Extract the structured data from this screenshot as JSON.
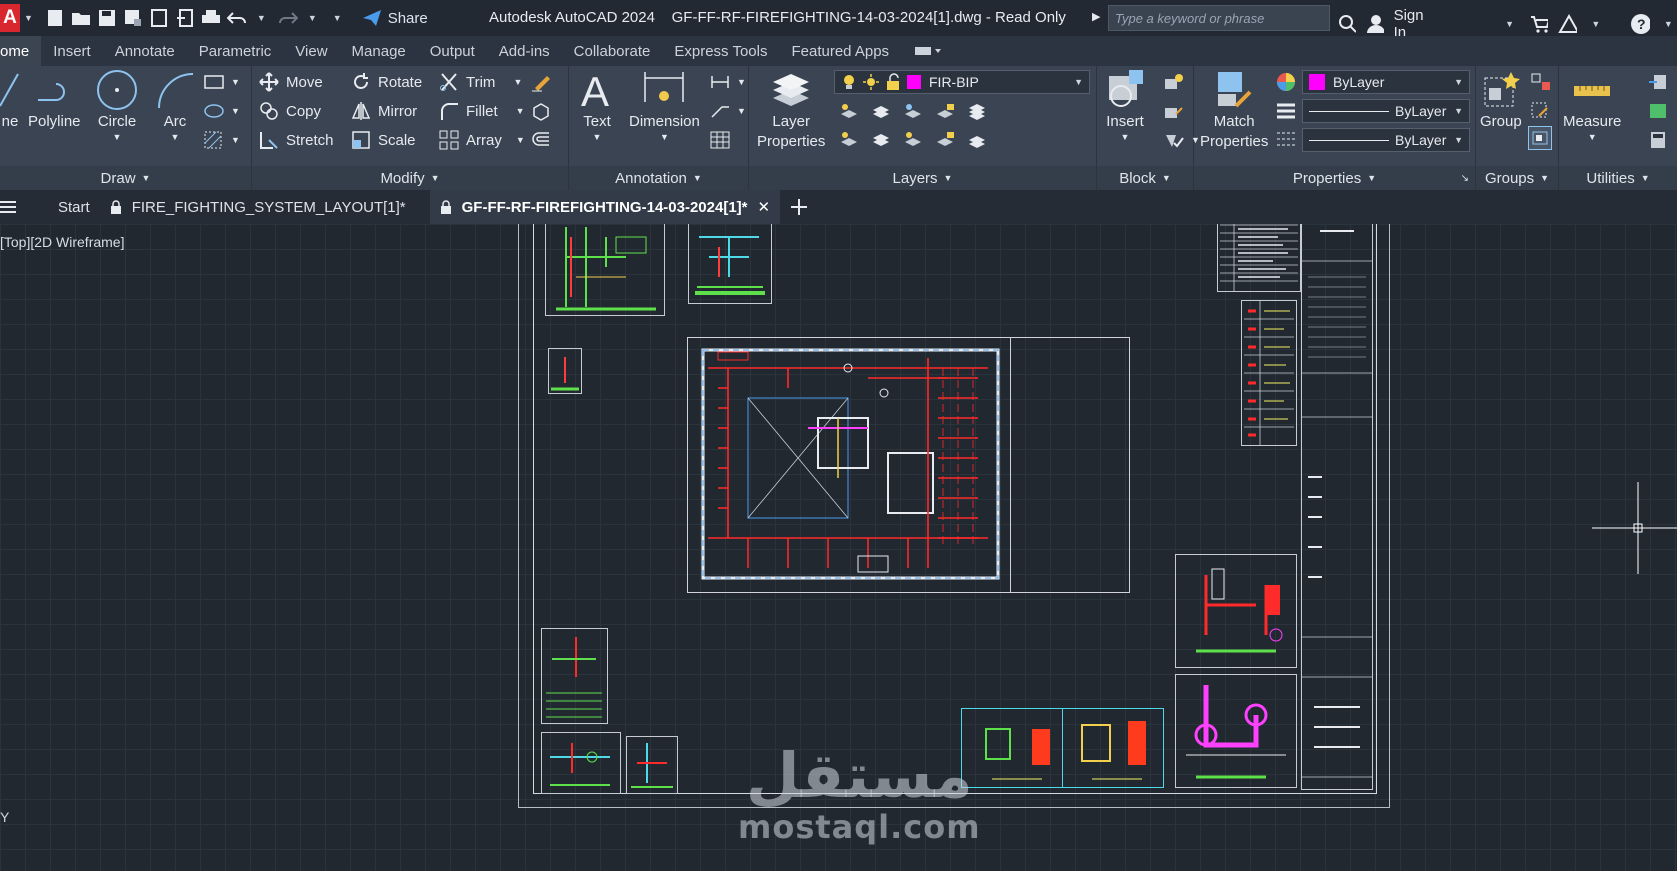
{
  "app": {
    "logo_letter": "A",
    "share_label": "Share",
    "title": "Autodesk AutoCAD 2024    GF-FF-RF-FIREFIGHTING-14-03-2024[1].dwg - Read Only",
    "search_placeholder": "Type a keyword or phrase",
    "sign_in": "Sign In"
  },
  "ribbon_tabs": [
    "ome",
    "Insert",
    "Annotate",
    "Parametric",
    "View",
    "Manage",
    "Output",
    "Add-ins",
    "Collaborate",
    "Express Tools",
    "Featured Apps"
  ],
  "draw": {
    "line": "ne",
    "polyline": "Polyline",
    "circle": "Circle",
    "arc": "Arc",
    "label": "Draw"
  },
  "modify": {
    "move": "Move",
    "rotate": "Rotate",
    "trim": "Trim",
    "copy": "Copy",
    "mirror": "Mirror",
    "fillet": "Fillet",
    "stretch": "Stretch",
    "scale": "Scale",
    "array": "Array",
    "label": "Modify"
  },
  "annotation": {
    "text": "Text",
    "dimension": "Dimension",
    "label": "Annotation"
  },
  "layers": {
    "layer_properties": "Layer\nProperties",
    "current_layer": "FIR-BIP",
    "label": "Layers"
  },
  "block": {
    "insert": "Insert",
    "label": "Block"
  },
  "properties": {
    "match": "Match\nProperties",
    "color": "ByLayer",
    "linetype": "ByLayer",
    "lineweight": "ByLayer",
    "label": "Properties"
  },
  "groups": {
    "group": "Group",
    "label": "Groups"
  },
  "utilities": {
    "measure": "Measure",
    "label": "Utilities"
  },
  "doc_tabs": {
    "start": "Start",
    "tab1": "FIRE_FIGHTING_SYSTEM_LAYOUT[1]*",
    "tab2": "GF-FF-RF-FIREFIGHTING-14-03-2024[1]*"
  },
  "viewport": {
    "label": "[Top][2D Wireframe]",
    "axis": "Y"
  },
  "watermark": {
    "arabic": "مستقل",
    "latin": "mostaql.com"
  },
  "colors": {
    "layer_swatch": "#ff00ff",
    "accent_red": "#d8272f"
  }
}
